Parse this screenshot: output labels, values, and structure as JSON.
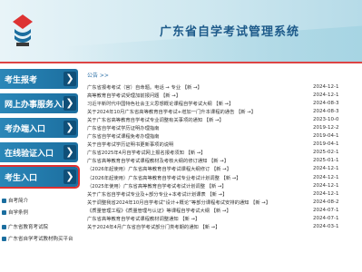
{
  "header": {
    "site_title": "广东省自学考试管理系统"
  },
  "nav": {
    "items": [
      {
        "label": "考生报考",
        "arrow": "❯"
      },
      {
        "label": "网上办事服务入口",
        "arrow": "❯"
      },
      {
        "label": "考办端入口",
        "arrow": "❯"
      },
      {
        "label": "在线验证入口",
        "arrow": "❯"
      },
      {
        "label": "考生入口",
        "arrow": "❯"
      }
    ]
  },
  "sublinks": [
    "自考简介",
    "自学条例",
    "广东省教育考试院",
    "广东省自学考试教材购买平台"
  ],
  "main": {
    "breadcrumb": "公告 >>",
    "news": [
      {
        "title": "广东省报考考试（官）自命题。电话 → 专业 【新 →】",
        "date": "2024-12-1"
      },
      {
        "title": "高等教育自学考试受理加前报问题 【新 →】",
        "date": "2024-12-1"
      },
      {
        "title": "习近平新时代中国特色社会主义思想概论课程自学考试大纲 【新 →】",
        "date": "2024-08-3"
      },
      {
        "title": "关于2024年10月广东省高等教育自学考试+增加一门升本课程的通告 【新 →】",
        "date": "2024-08-3"
      },
      {
        "title": "关于广东省高等教育自学考试专业调整有关事项的通知 【新 →】",
        "date": "2023-10-0"
      },
      {
        "title": "广东省自学考试学历证明办理指南",
        "date": "2019-12-2"
      },
      {
        "title": "广东省自学考试课程免考办理指南",
        "date": "2019-04-1"
      },
      {
        "title": "关于自学考试学历证明书更新事项的说明",
        "date": "2019-04-1"
      },
      {
        "title": "广东省2025年4月自学考试网上报名报考须知 【新 →】",
        "date": "2025-02-1"
      },
      {
        "title": "广东省高等教育自学考试课程教材及考核大纲的修订通知 【新 →】",
        "date": "2025-01-1"
      },
      {
        "title": "（2026年起使用）广东省高等教育自学考试课程大纲修订 【新 →】",
        "date": "2024-12-1"
      },
      {
        "title": "（2026年起使用）广东省高等教育自学考试专业考试计划调整 【新 →】",
        "date": "2024-12-1"
      },
      {
        "title": "（2025年使用）广东省高等教育自学考试考试计划调整 【新 →】",
        "date": "2024-12-1"
      },
      {
        "title": "关于广东省自学考试专业及+部分专业+本考试计划课表 【新 →】",
        "date": "2024-12-1"
      },
      {
        "title": "关于调整我省2024年10月自学考试“设计+概论”等部分课程考试安排的通知 【新 →】",
        "date": "2024-08-2"
      },
      {
        "title": "《质量管理工程》《质量管理与认证》等课程自学考试大纲 【新 →】",
        "date": "2024-07-1"
      },
      {
        "title": "广东省高等教育自学考试课程教材调整通知 【新 →】",
        "date": "2024-07-1"
      },
      {
        "title": "关于2024年4月广东省自学考试部分门类考期的通知 【新 →】",
        "date": "2024-03-1"
      }
    ]
  }
}
